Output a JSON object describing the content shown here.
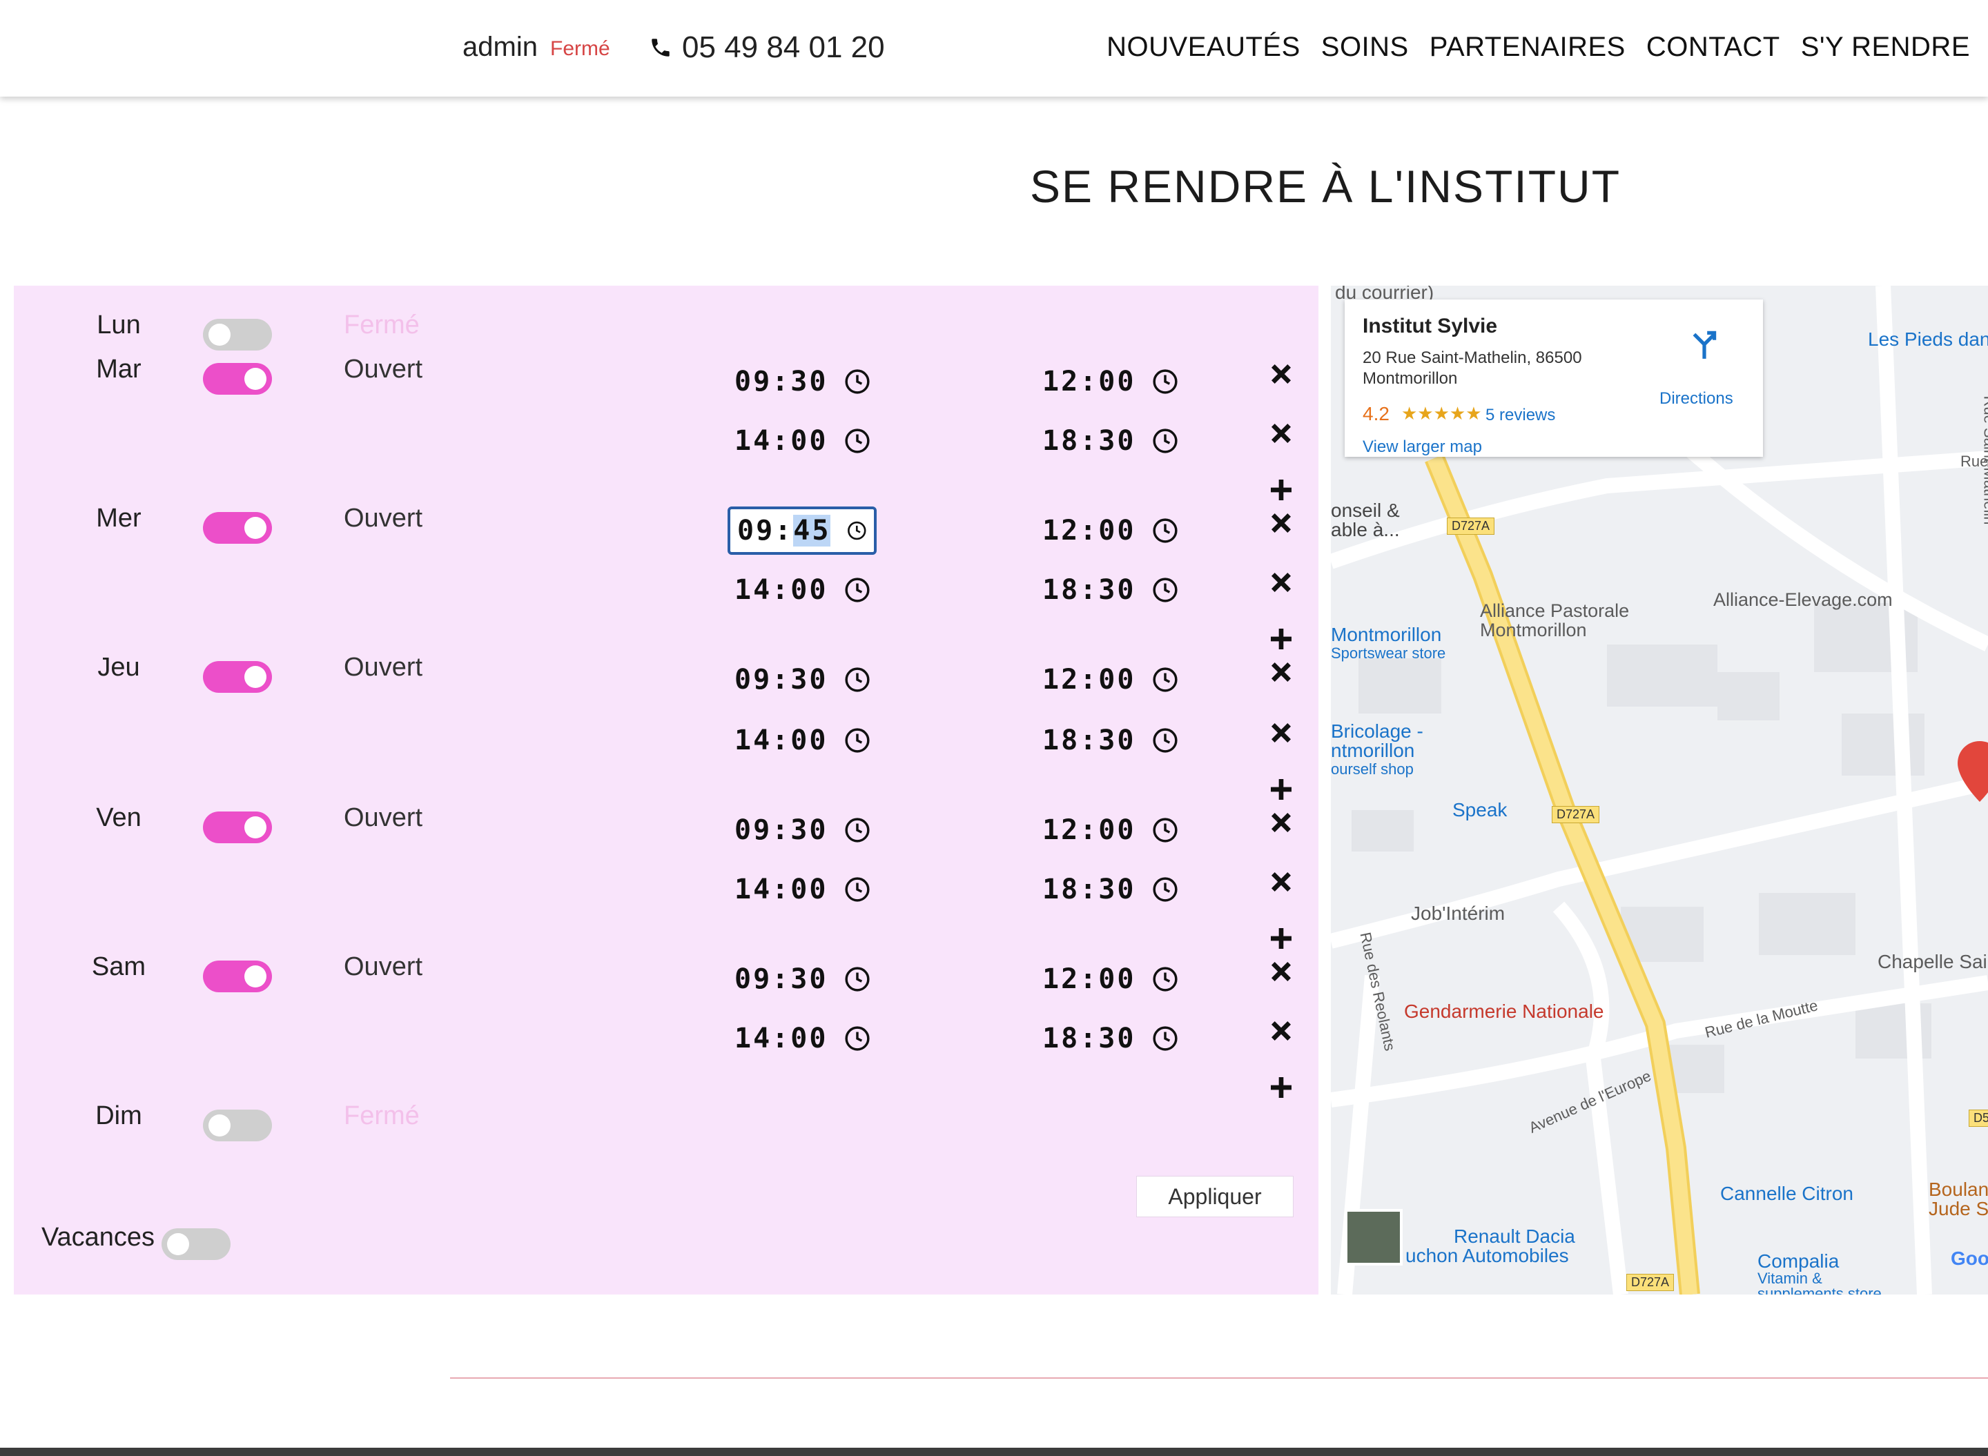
{
  "header": {
    "user": "admin",
    "shop_status": "Fermé",
    "phone": "05 49 84 01 20",
    "nav": [
      "NOUVEAUTÉS",
      "SOINS",
      "PARTENAIRES",
      "CONTACT",
      "S'Y RENDRE"
    ]
  },
  "page_title": "SE RENDRE À L'INSTITUT",
  "schedule": {
    "days": [
      {
        "name": "Lun",
        "enabled": false,
        "status": "Fermé",
        "slots": []
      },
      {
        "name": "Mar",
        "enabled": true,
        "status": "Ouvert",
        "slots": [
          {
            "start": "09:30",
            "end": "12:00"
          },
          {
            "start": "14:00",
            "end": "18:30"
          }
        ]
      },
      {
        "name": "Mer",
        "enabled": true,
        "status": "Ouvert",
        "slots": [
          {
            "start_h": "09",
            "start_m": "45",
            "end": "12:00"
          },
          {
            "start": "14:00",
            "end": "18:30"
          }
        ]
      },
      {
        "name": "Jeu",
        "enabled": true,
        "status": "Ouvert",
        "slots": [
          {
            "start": "09:30",
            "end": "12:00"
          },
          {
            "start": "14:00",
            "end": "18:30"
          }
        ]
      },
      {
        "name": "Ven",
        "enabled": true,
        "status": "Ouvert",
        "slots": [
          {
            "start": "09:30",
            "end": "12:00"
          },
          {
            "start": "14:00",
            "end": "18:30"
          }
        ]
      },
      {
        "name": "Sam",
        "enabled": true,
        "status": "Ouvert",
        "slots": [
          {
            "start": "09:30",
            "end": "12:00"
          },
          {
            "start": "14:00",
            "end": "18:30"
          }
        ]
      },
      {
        "name": "Dim",
        "enabled": false,
        "status": "Fermé",
        "slots": []
      }
    ],
    "apply_label": "Appliquer",
    "vacances_label": "Vacances",
    "vacances_enabled": false
  },
  "colors": {
    "toggle_on": "#ec4fc9",
    "panel_bg": "#f9e4fb",
    "closed_text": "#d64545"
  },
  "map": {
    "card": {
      "name": "Institut Sylvie",
      "address": "20 Rue Saint-Mathelin, 86500 Montmorillon",
      "rating": "4.2",
      "stars": "★★★★★",
      "reviews": "5 reviews",
      "larger_map": "View larger map",
      "directions": "Directions"
    },
    "places": {
      "conseil": "onseil &",
      "conseil2": "able à...",
      "alliance_pastorale": "Alliance Pastorale",
      "alliance_pastorale2": "Montmorillon",
      "alliance_elevage": "Alliance-Elevage.com",
      "montmorillon_sport": "Montmorillon",
      "montmorillon_sport2": "Sportswear store",
      "bricolage": "Bricolage -",
      "bricolage2": "ntmorillon",
      "bricolage3": "ourself shop",
      "speak": "Speak",
      "jobinterim": "Job'Intérim",
      "gendarmerie": "Gendarmerie Nationale",
      "chapelle": "Chapelle Sain",
      "les_pieds": "Les Pieds dan",
      "cannelle": "Cannelle Citron",
      "renault": "Renault Dacia",
      "renault2": "uchon Automobiles",
      "compalia": "Compalia",
      "compalia2": "Vitamin &",
      "compalia3": "supplements store",
      "boulan": "Boulan",
      "boulan2": "Jude S",
      "google": "Goo"
    },
    "streets": {
      "rue_saint_mathelin": "Rue Saint-Mathelin",
      "rue_moutte": "Rue de la Moutte",
      "av_europe": "Avenue de l'Europe",
      "rue_reolants": "Rue des Reolants",
      "rue_short": "Rue",
      "du_courrier": "du courrier)",
      "d727a": "D727A",
      "d5": "D5"
    }
  }
}
